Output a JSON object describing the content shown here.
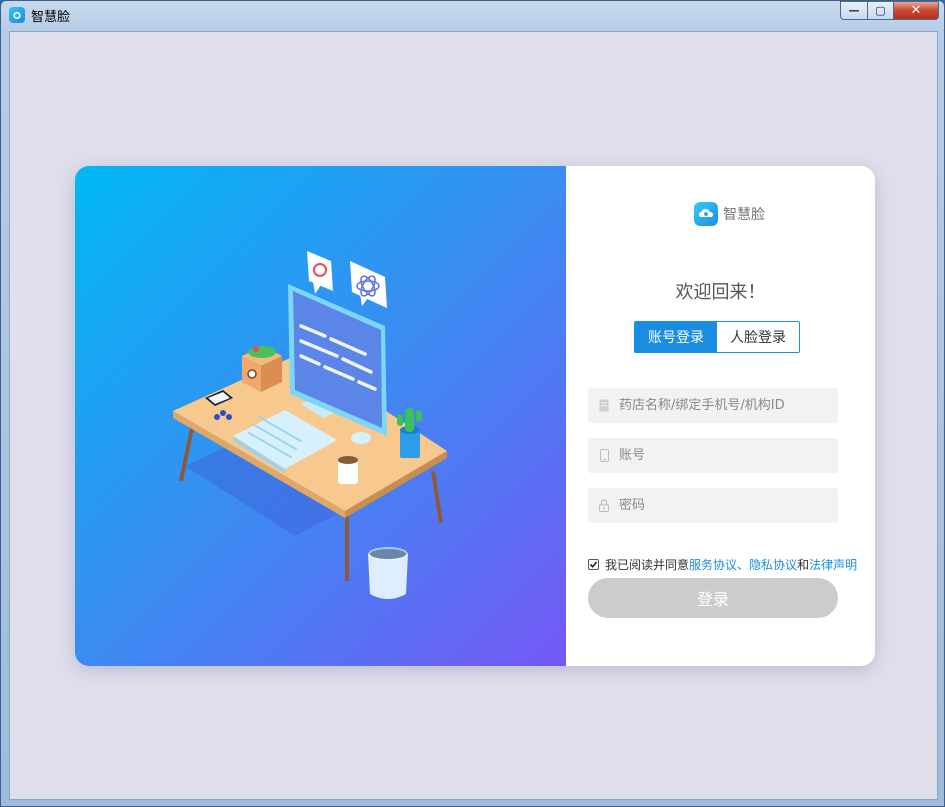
{
  "window": {
    "title": "智慧脸",
    "minimize_symbol": "—",
    "maximize_symbol": "▢",
    "close_symbol": "✕"
  },
  "login": {
    "brand_name": "智慧脸",
    "welcome": "欢迎回来！",
    "tabs": [
      {
        "label": "账号登录",
        "active": true
      },
      {
        "label": "人脸登录",
        "active": false
      }
    ],
    "fields": {
      "store": {
        "placeholder": "药店名称/绑定手机号/机构ID",
        "icon": "building-icon"
      },
      "account": {
        "placeholder": "账号",
        "icon": "phone-icon"
      },
      "password": {
        "placeholder": "密码",
        "icon": "lock-icon"
      }
    },
    "agreement": {
      "checked": true,
      "prefix": "我已阅读并同意",
      "service": "服务协议",
      "sep": "、",
      "privacy": "隐私协议",
      "and": "和",
      "legal": "法律声明"
    },
    "submit_label": "登录"
  },
  "colors": {
    "accent": "#1a8de0",
    "gradient_start": "#00b8f4",
    "gradient_end": "#7558f5",
    "disabled_button": "#cccccc"
  }
}
